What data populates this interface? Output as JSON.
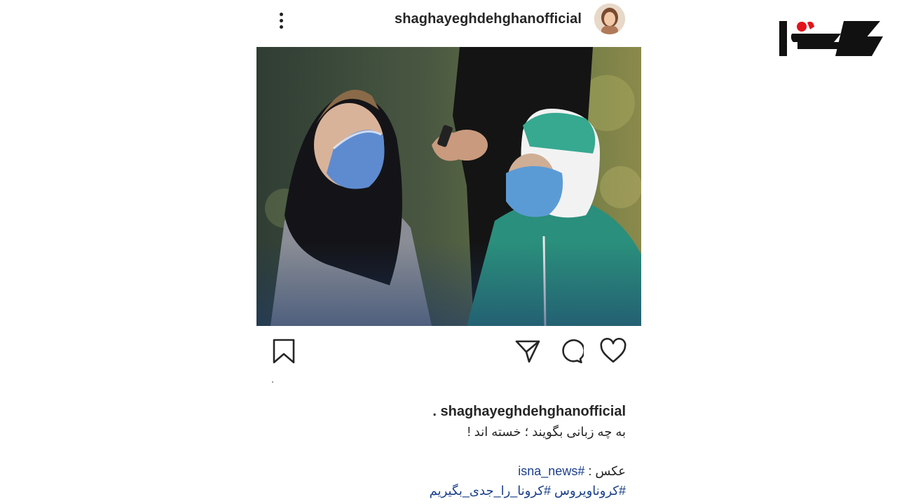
{
  "post": {
    "username": "shaghayeghdehghanofficial",
    "more_icon": "more-vertical-icon",
    "avatar_icon": "profile-avatar"
  },
  "logo": {
    "name": "rokna-logo",
    "brand_color": "#e3131b"
  },
  "actions": {
    "save_icon": "bookmark-icon",
    "share_icon": "send-icon",
    "comment_icon": "comment-icon",
    "like_icon": "heart-icon"
  },
  "caption": {
    "username": "shaghayeghdehghanofficial",
    "separator": ".",
    "line1": "به چه زبانی بگویند ؛ خسته اند !",
    "credit_label": "عکس :",
    "credit_tag": "#isna_news",
    "hashtags": "#کروناویروس #کرونا_را_جدی_بگیریم"
  },
  "colors": {
    "text": "#262626",
    "hashtag": "#1a3f8c"
  }
}
